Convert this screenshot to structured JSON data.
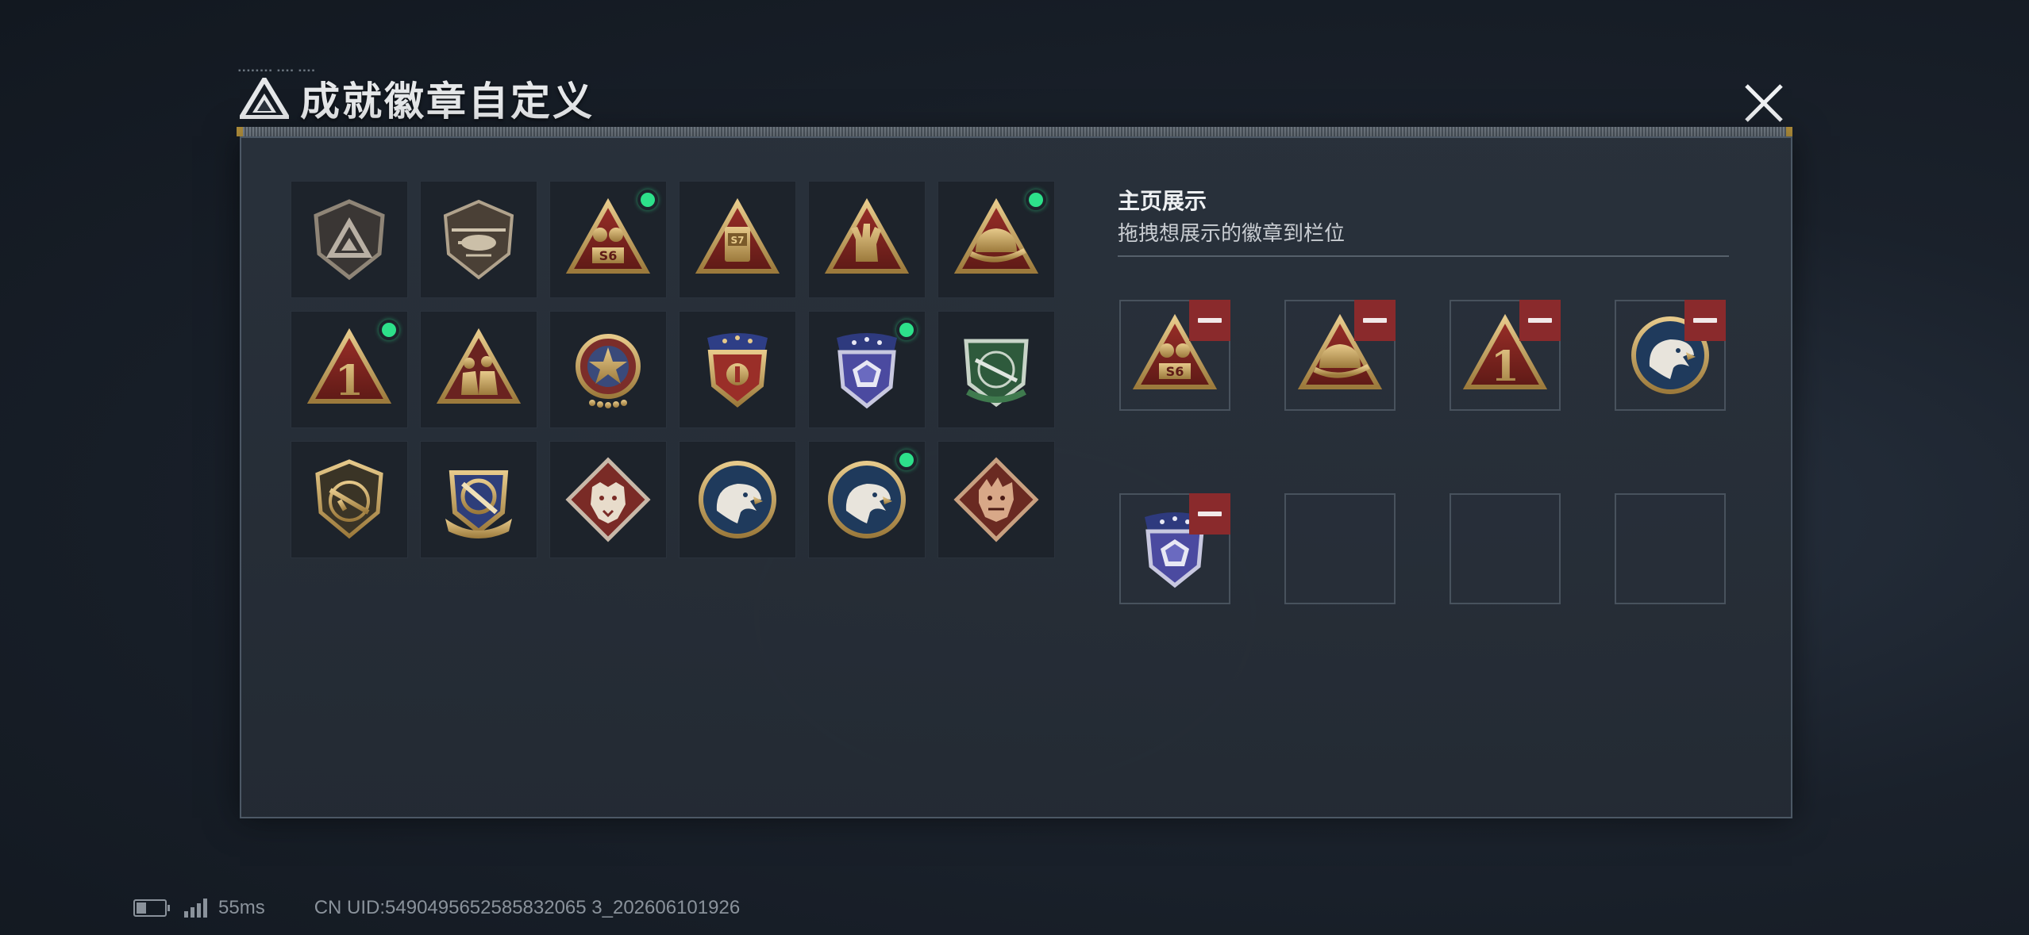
{
  "dialog": {
    "title": "成就徽章自定义",
    "close_label": "close"
  },
  "badge_grid": [
    {
      "icon": "shield-triangle-badge-icon",
      "new": false
    },
    {
      "icon": "helicopter-shield-badge-icon",
      "new": false
    },
    {
      "icon": "s6-triangle-badge-icon",
      "new": true
    },
    {
      "icon": "s7-triangle-badge-icon",
      "new": false
    },
    {
      "icon": "hand-gesture-triangle-badge-icon",
      "new": false
    },
    {
      "icon": "helmet-triangle-badge-icon",
      "new": true
    },
    {
      "icon": "number-one-triangle-badge-icon",
      "new": true
    },
    {
      "icon": "soldiers-triangle-badge-icon",
      "new": false
    },
    {
      "icon": "star-round-badge-icon",
      "new": false
    },
    {
      "icon": "red-shield-badge-icon",
      "new": false
    },
    {
      "icon": "purple-shield-badge-icon",
      "new": true
    },
    {
      "icon": "green-rifle-shield-badge-icon",
      "new": false
    },
    {
      "icon": "rifle-shield-badge-icon",
      "new": false
    },
    {
      "icon": "crosshair-shield-badge-icon",
      "new": false
    },
    {
      "icon": "wolf-diamond-badge-icon",
      "new": false
    },
    {
      "icon": "eagle-round-badge-icon",
      "new": false
    },
    {
      "icon": "eagle-round-badge-icon",
      "new": true
    },
    {
      "icon": "dragon-diamond-badge-icon",
      "new": false
    }
  ],
  "showcase": {
    "title": "主页展示",
    "subtitle": "拖拽想展示的徽章到栏位",
    "slots": [
      {
        "icon": "s6-triangle-badge-icon",
        "filled": true
      },
      {
        "icon": "helmet-triangle-badge-icon",
        "filled": true
      },
      {
        "icon": "number-one-triangle-badge-icon",
        "filled": true
      },
      {
        "icon": "eagle-round-badge-icon",
        "filled": true
      },
      {
        "icon": "purple-shield-badge-icon",
        "filled": true
      },
      {
        "icon": "",
        "filled": false
      },
      {
        "icon": "",
        "filled": false
      },
      {
        "icon": "",
        "filled": false
      }
    ]
  },
  "status_bar": {
    "ping": "55ms",
    "uid": "CN UID:5490495652585832065 3_202606101926"
  },
  "colors": {
    "new_dot": "#2de08a",
    "remove_button": "#8a2a2c",
    "gold": "#c9a45a",
    "badge_red": "#7a2420"
  }
}
